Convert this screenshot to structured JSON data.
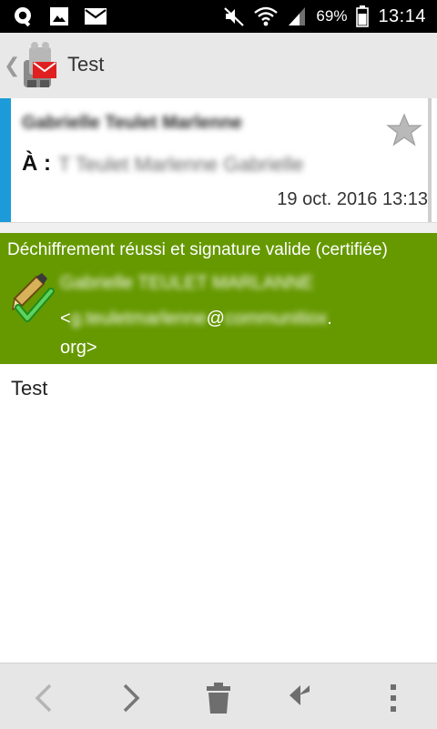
{
  "status_bar": {
    "battery_percent": "69%",
    "time": "13:14",
    "icons": [
      "search-icon",
      "image-icon",
      "mail-icon",
      "mute-icon",
      "wifi-icon",
      "signal-icon",
      "battery-icon"
    ]
  },
  "action_bar": {
    "title": "Test",
    "icons": [
      "back-chevron-icon",
      "app-logo-icon"
    ]
  },
  "message_header": {
    "sender": "Gabrielle Teulet Marlenne",
    "to_label": "À :",
    "to_value": "T Teulet Marlenne Gabrielle",
    "date": "19 oct. 2016 13:13",
    "accent_color": "#1c9bd8"
  },
  "crypto": {
    "status": "Déchiffrement réussi et signature valide (certifiée)",
    "signer_name": "Gabrielle TEULET MARLANNE",
    "email_prefix": "<",
    "email_local": "g.teuletmarlenne",
    "email_at": "@",
    "email_domain": "communitiox",
    "email_suffix": ".",
    "email_tld": "org>",
    "color": "#669900"
  },
  "body": {
    "text": "Test"
  },
  "bottom_bar": {
    "buttons": [
      "previous-icon",
      "next-icon",
      "delete-icon",
      "reply-all-icon",
      "overflow-menu-icon"
    ]
  }
}
